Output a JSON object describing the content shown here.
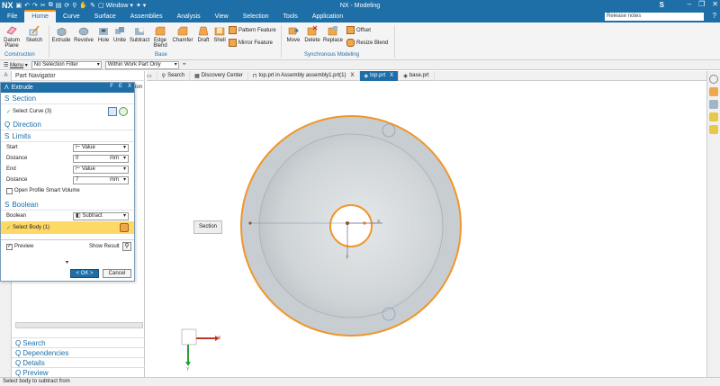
{
  "app": {
    "logo": "NX",
    "window_menu": "Window",
    "title": "NX - Modeling",
    "brand_badge": "S"
  },
  "menu": {
    "items": [
      "File",
      "Home",
      "Curve",
      "Surface",
      "Assemblies",
      "Analysis",
      "View",
      "Selection",
      "Tools",
      "Application"
    ],
    "active": "Home",
    "search_placeholder": "Release notes"
  },
  "ribbon": {
    "tools": {
      "datum_plane": "Datum Plane",
      "sketch": "Sketch",
      "extrude": "Extrude",
      "revolve": "Revolve",
      "hole": "Hole",
      "unite": "Unite",
      "subtract": "Subtract",
      "edge_blend": "Edge Blend",
      "chamfer": "Chamfer",
      "draft": "Draft",
      "shell": "Shell",
      "pattern_feature": "Pattern Feature",
      "mirror_feature": "Mirror Feature",
      "move": "Move",
      "delete": "Delete",
      "replace": "Replace",
      "offset": "Offset",
      "resize_blend": "Resize Blend"
    },
    "groups": {
      "construction": "Construction",
      "base": "Base",
      "sync": "Synchronous Modeling"
    }
  },
  "selection_bar": {
    "menu": "Menu",
    "filter": "No Selection Filter",
    "scope": "Within Work Part Only"
  },
  "tabs": [
    {
      "label": "Search",
      "active": false
    },
    {
      "label": "Discovery Center",
      "active": false
    },
    {
      "label": "top.prt in Assembly assembly1.prt(1)",
      "active": false,
      "close": "X"
    },
    {
      "label": "top.prt",
      "active": true,
      "close": "X"
    },
    {
      "label": "base.prt",
      "active": false
    }
  ],
  "part_navigator": {
    "title": "Part Navigator",
    "bottom_links": [
      "Search",
      "Dependencies",
      "Details",
      "Preview"
    ],
    "clipped_text": "ion"
  },
  "dialog": {
    "title": "Extrude",
    "title_controls": [
      "F",
      "E",
      "X"
    ],
    "section": {
      "title": "Section",
      "select_curve": "Select Curve (3)"
    },
    "direction": {
      "title": "Direction"
    },
    "limits": {
      "title": "Limits",
      "start_label": "Start",
      "start_value": "Value",
      "start_distance_label": "Distance",
      "start_distance": "0",
      "start_unit": "mm",
      "end_label": "End",
      "end_value": "Value",
      "end_distance_label": "Distance",
      "end_distance": "7",
      "end_unit": "mm",
      "open_profile": "Open Profile Smart Volume"
    },
    "boolean": {
      "title": "Boolean",
      "boolean_label": "Boolean",
      "boolean_value": "Subtract",
      "select_body": "Select Body (1)"
    },
    "preview_label": "Preview",
    "show_result": "Show Result",
    "ok": "< OK >",
    "cancel": "Cancel"
  },
  "viewport": {
    "section_label": "Section",
    "axis_x": "X",
    "axis_y": "Y"
  },
  "status": {
    "text": "Select body to subtract from"
  }
}
